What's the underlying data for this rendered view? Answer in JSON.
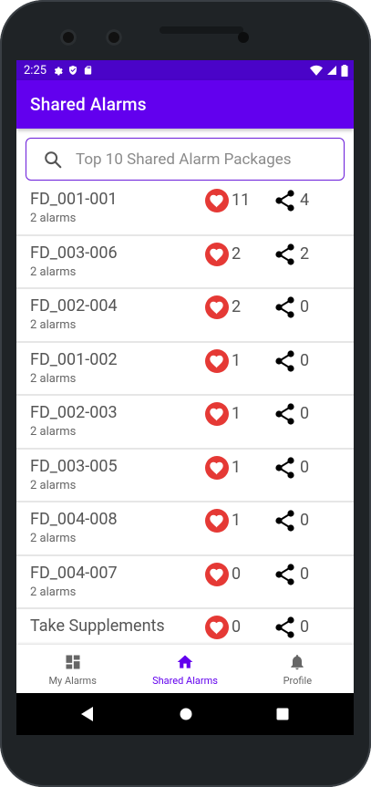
{
  "status": {
    "time": "2:25"
  },
  "appbar": {
    "title": "Shared Alarms"
  },
  "search": {
    "placeholder": "Top 10 Shared Alarm Packages"
  },
  "items": [
    {
      "name": "FD_001-001",
      "sub": "2 alarms",
      "likes": "11",
      "shares": "4"
    },
    {
      "name": "FD_003-006",
      "sub": "2 alarms",
      "likes": "2",
      "shares": "2"
    },
    {
      "name": "FD_002-004",
      "sub": "2 alarms",
      "likes": "2",
      "shares": "0"
    },
    {
      "name": "FD_001-002",
      "sub": "2 alarms",
      "likes": "1",
      "shares": "0"
    },
    {
      "name": "FD_002-003",
      "sub": "2 alarms",
      "likes": "1",
      "shares": "0"
    },
    {
      "name": "FD_003-005",
      "sub": "2 alarms",
      "likes": "1",
      "shares": "0"
    },
    {
      "name": "FD_004-008",
      "sub": "2 alarms",
      "likes": "1",
      "shares": "0"
    },
    {
      "name": "FD_004-007",
      "sub": "2 alarms",
      "likes": "0",
      "shares": "0"
    },
    {
      "name": "Take Supplements",
      "sub": "",
      "likes": "0",
      "shares": "0"
    }
  ],
  "nav": {
    "my_alarms": "My Alarms",
    "shared_alarms": "Shared Alarms",
    "profile": "Profile"
  },
  "colors": {
    "primary": "#6200ee",
    "statusbar": "#4a04c8",
    "heart": "#e53935"
  }
}
